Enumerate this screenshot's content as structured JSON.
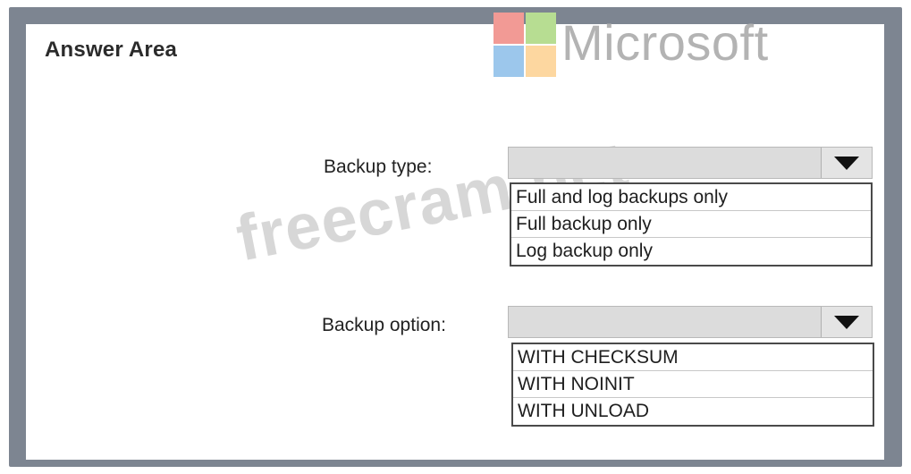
{
  "title": "Answer Area",
  "watermarks": {
    "brand_text": "Microsoft",
    "site_text": "freecram.net"
  },
  "colors": {
    "frame": "#7d8591",
    "logo_red": "#f29a95",
    "logo_green": "#b7dd92",
    "logo_blue": "#9cc7ec",
    "logo_yellow": "#fdd7a0"
  },
  "backup_type": {
    "label": "Backup type:",
    "selected": "",
    "options": [
      "Full and log backups only",
      "Full backup only",
      "Log backup only"
    ]
  },
  "backup_option": {
    "label": "Backup option:",
    "selected": "",
    "options": [
      "WITH CHECKSUM",
      "WITH NOINIT",
      "WITH UNLOAD"
    ]
  },
  "icons": {
    "dropdown": "chevron-down-icon"
  }
}
